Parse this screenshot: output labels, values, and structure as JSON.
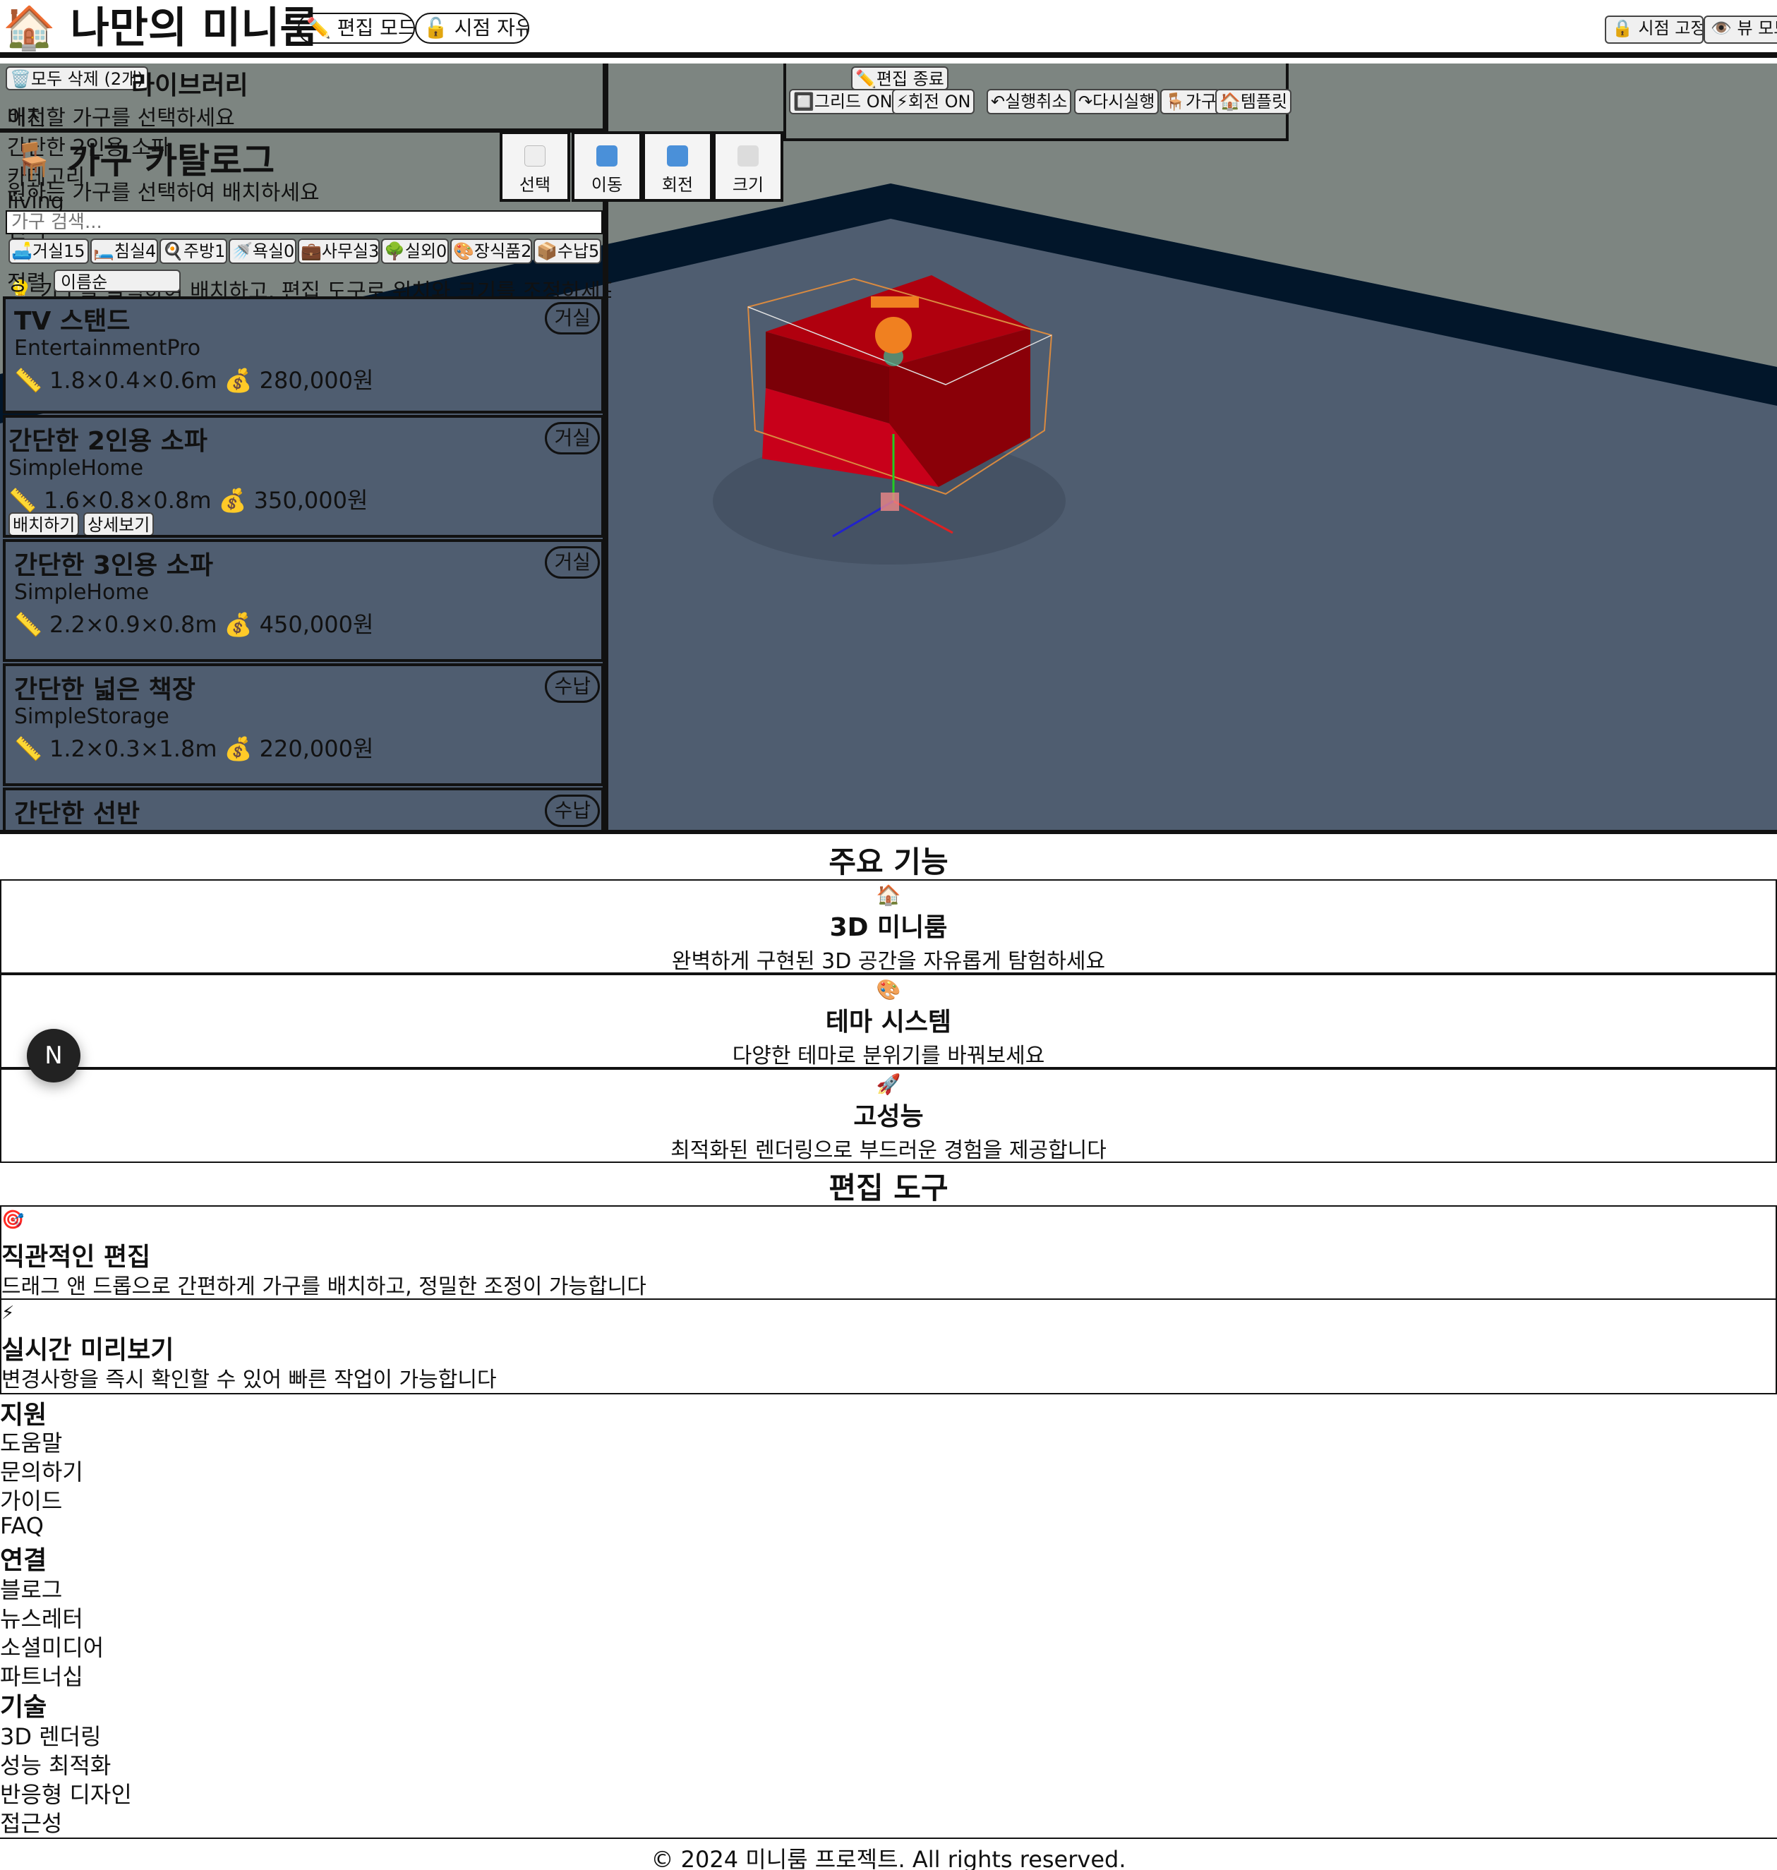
{
  "header": {
    "logo_emoji": "🏠",
    "title": "나만의 미니룸",
    "edit_mode": "✏️ 편집 모드",
    "view_free": "🔓 시점 자유",
    "view_lock": "🔒 시점 고정",
    "view_mode": "👁️ 뷰 모드"
  },
  "library": {
    "delete_all": "🗑️모두 삭제 (2개)",
    "title": "라이브러리",
    "subtitle": "배치할 가구를 선택하세요",
    "overlap_items": [
      "이전",
      "간단한 2인용 소파",
      "카테고리",
      "living",
      "선택",
      "간단한 2인용 소파",
      "정렬",
      "이름순"
    ]
  },
  "catalog": {
    "icon": "🪑",
    "title": "가구 카탈로그",
    "subtitle": "원하는 가구를 선택하여 배치하세요",
    "search_placeholder": "가구 검색...",
    "categories": [
      "🛋️거실15",
      "🛏️침실4",
      "🍳주방1",
      "🚿욕실0",
      "💼사무실3",
      "🌳실외0",
      "🎨장식품2",
      "📦수납5"
    ],
    "hint": "💡 가구를 클릭하여 배치하고, 편집 도구로 위치와 크기를 조정하세요",
    "sort_label": "정렬",
    "sort_value": "이름순",
    "items": [
      {
        "name": "TV 스탠드",
        "brand": "EntertainmentPro",
        "dims": "📏 1.8×0.4×0.6m",
        "price": "💰 280,000원",
        "category": "거실"
      },
      {
        "name": "간단한 2인용 소파",
        "brand": "SimpleHome",
        "dims": "📏 1.6×0.8×0.8m",
        "price": "💰 350,000원",
        "category": "거실",
        "place": "배치하기",
        "detail": "상세보기"
      },
      {
        "name": "간단한 3인용 소파",
        "brand": "SimpleHome",
        "dims": "📏 2.2×0.9×0.8m",
        "price": "💰 450,000원",
        "category": "거실"
      },
      {
        "name": "간단한 넓은 책장",
        "brand": "SimpleStorage",
        "dims": "📏 1.2×0.3×1.8m",
        "price": "💰 220,000원",
        "category": "수납"
      },
      {
        "name": "간단한 선반",
        "brand": "",
        "dims": "",
        "price": "",
        "category": "수납"
      }
    ]
  },
  "tools": {
    "select": "선택",
    "move": "이동",
    "rotate": "회전",
    "scale": "크기"
  },
  "toolbar": {
    "exit_edit": "✏️편집 종료",
    "grid": "🔲그리드 ON",
    "snap": "⚡회전 ON",
    "undo": "↶실행취소",
    "redo": "↷다시실행",
    "furniture": "🪑가구",
    "template": "🏠템플릿"
  },
  "features": {
    "title": "주요 기능",
    "items": [
      {
        "icon": "🏠",
        "title": "3D 미니룸",
        "desc": "완벽하게 구현된 3D 공간을 자유롭게 탐험하세요"
      },
      {
        "icon": "🎨",
        "title": "테마 시스템",
        "desc": "다양한 테마로 분위기를 바꿔보세요"
      },
      {
        "icon": "🚀",
        "title": "고성능",
        "desc": "최적화된 렌더링으로 부드러운 경험을 제공합니다"
      }
    ]
  },
  "edit_tools": {
    "title": "편집 도구",
    "items": [
      {
        "icon": "🎯",
        "title": "직관적인 편집",
        "desc": "드래그 앤 드롭으로 간편하게 가구를 배치하고, 정밀한 조정이 가능합니다"
      },
      {
        "icon": "⚡",
        "title": "실시간 미리보기",
        "desc": "변경사항을 즉시 확인할 수 있어 빠른 작업이 가능합니다"
      }
    ]
  },
  "footer": {
    "support": {
      "title": "지원",
      "links": [
        "도움말",
        "문의하기",
        "가이드",
        "FAQ"
      ]
    },
    "connect": {
      "title": "연결",
      "links": [
        "블로그",
        "뉴스레터",
        "소셜미디어",
        "파트너십"
      ]
    },
    "tech": {
      "title": "기술",
      "links": [
        "3D 렌더링",
        "성능 최적화",
        "반응형 디자인",
        "접근성"
      ]
    },
    "copyright": "© 2024 미니룸 프로젝트. All rights reserved."
  },
  "dev_badge": "N",
  "colors": {
    "floor": "#4f5d70",
    "wall": "#7d8581",
    "wall_trim": "#02162a",
    "sofa": "#a0000c",
    "panel_border": "#111111"
  }
}
